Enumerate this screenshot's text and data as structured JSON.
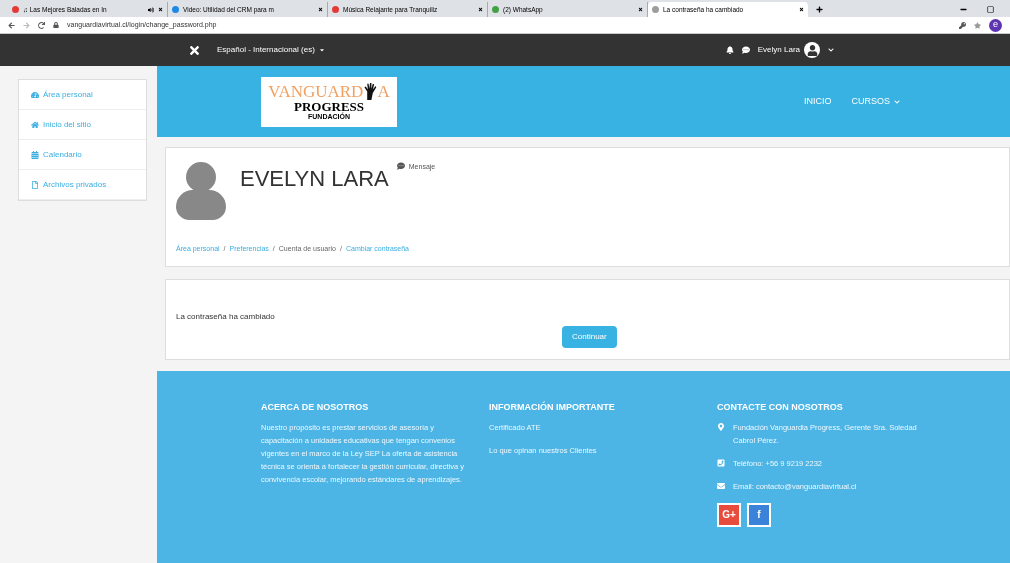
{
  "browser": {
    "tabs": [
      {
        "title": "♫ Las Mejores Baladas en In",
        "selected": false,
        "color": "#e53935",
        "audio": true
      },
      {
        "title": "Video: Utilidad del CRM para m",
        "selected": false,
        "color": "#1e88e5",
        "audio": false
      },
      {
        "title": "Música Relajante para Tranquiliz",
        "selected": false,
        "color": "#e53935",
        "audio": false
      },
      {
        "title": "(2) WhatsApp",
        "selected": false,
        "color": "#43a047",
        "audio": false
      },
      {
        "title": "La contraseña ha cambiado",
        "selected": true,
        "color": "#9e9e9e",
        "audio": false
      }
    ],
    "url": "vanguardiavirtual.cl/login/change_password.php",
    "profile_initial": "e"
  },
  "topbar": {
    "language": "Español - Internacional (es)",
    "user": "Evelyn Lara"
  },
  "sidebar": {
    "items": [
      {
        "label": "Área personal",
        "kind": "dashboard"
      },
      {
        "label": "Inicio del sitio",
        "kind": "home"
      },
      {
        "label": "Calendario",
        "kind": "calendar"
      },
      {
        "label": "Archivos privados",
        "kind": "file"
      }
    ]
  },
  "header": {
    "logo": {
      "line1_left": "VANGUARD",
      "line1_right": "A",
      "line2": "PROGRESS",
      "line3": "FUNDACIÓN"
    },
    "nav": [
      {
        "label": "INICIO",
        "dropdown": false
      },
      {
        "label": "CURSOS",
        "dropdown": true
      }
    ]
  },
  "profile": {
    "name": "EVELYN LARA",
    "message": "Mensaje",
    "breadcrumb_separator": "/",
    "breadcrumb": [
      {
        "label": "Área personal",
        "link": true
      },
      {
        "label": "Preferencias",
        "link": true
      },
      {
        "label": "Cuenta de usuario",
        "link": false
      },
      {
        "label": "Cambiar contraseña",
        "link": true
      }
    ]
  },
  "notice": {
    "text": "La contraseña ha cambiado",
    "button": "Continuar"
  },
  "footer": {
    "columns": [
      {
        "title": "ACERCA DE NOSOTROS",
        "lines": [
          {
            "text": "Nuestro propósito es prestar servicios de asesoría y capacitación a unidades educativas que tengan convenios vigentes en el marco de la Ley SEP La oferta de asistencia técnica se orienta a fortalecer la gestión curricular, directiva y convivencia escolar, mejorando estándares de aprendizajes.",
            "kind": "text"
          }
        ]
      },
      {
        "title": "INFORMACIÓN IMPORTANTE",
        "lines": [
          {
            "text": "Certificado ATE",
            "kind": "link"
          },
          {
            "text": "Lo que opinan nuestros Clientes",
            "kind": "link"
          }
        ]
      },
      {
        "title": "CONTACTE CON NOSOTROS",
        "lines": [
          {
            "text": "Fundación Vanguardia Progress, Gerente Sra. Soledad Cabrol Pérez.",
            "kind": "address"
          },
          {
            "text": "Teléfono: +56 9 9219 2232",
            "kind": "phone"
          },
          {
            "text": "Email: contacto@vanguardiavirtual.cl",
            "kind": "email"
          }
        ]
      }
    ],
    "social": [
      {
        "label": "G+",
        "color": "#e74c3c"
      },
      {
        "label": "f",
        "color": "#3b83d8"
      }
    ]
  }
}
